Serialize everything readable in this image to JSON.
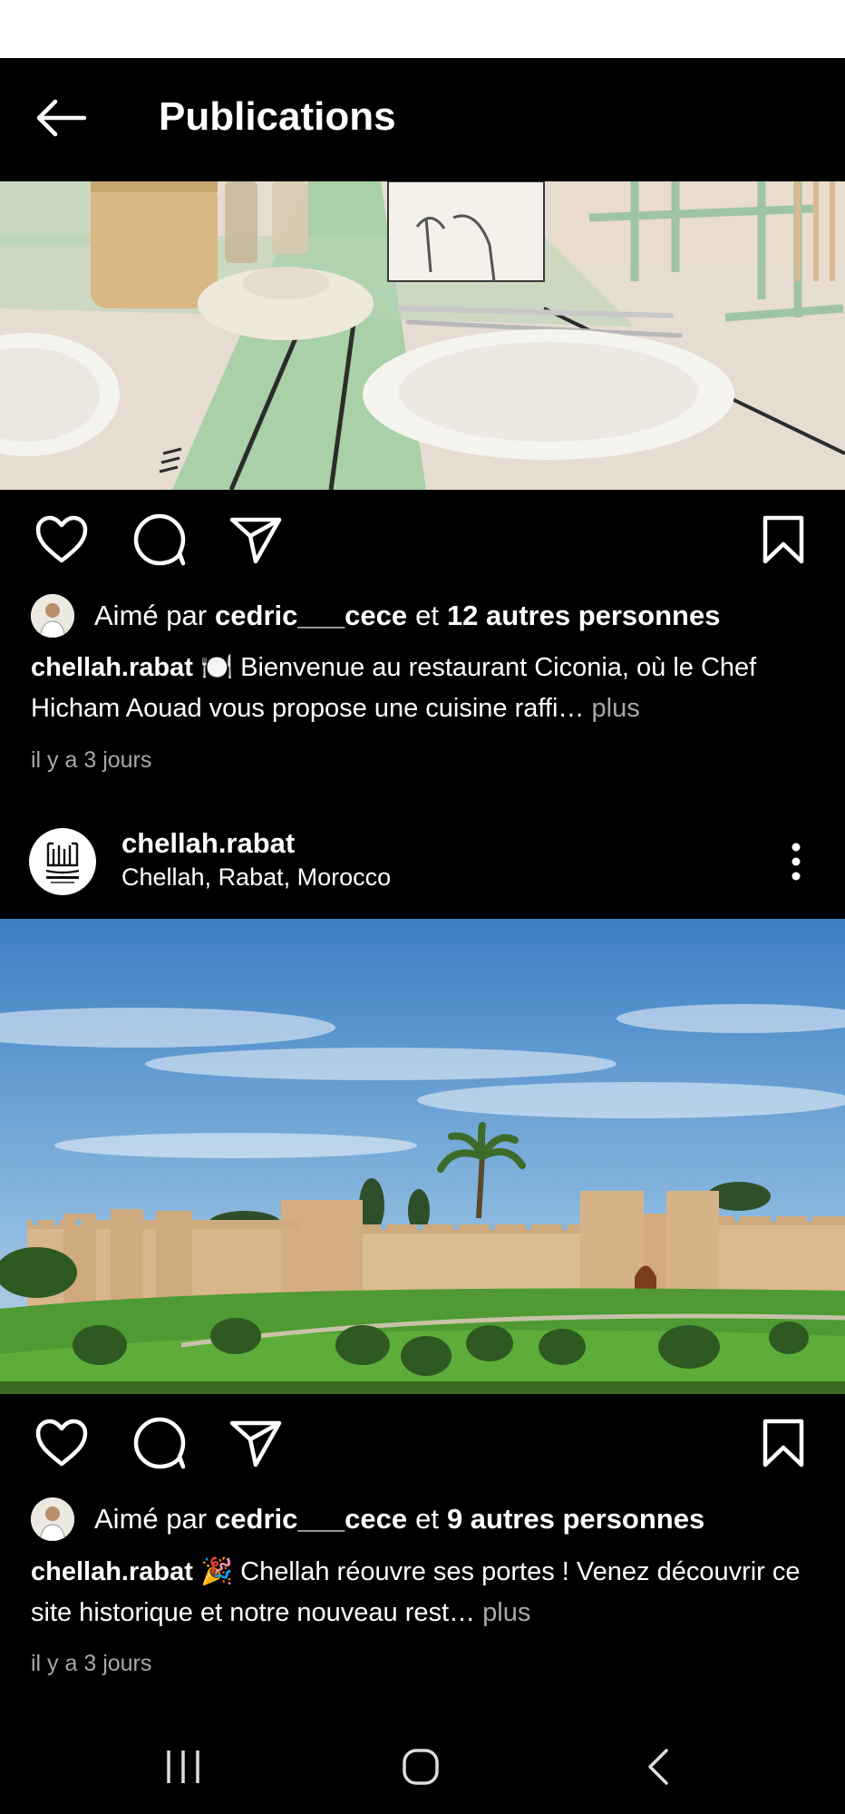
{
  "header": {
    "title": "Publications",
    "back_icon": "arrow-left-icon"
  },
  "posts": [
    {
      "image_alt": "Restaurant table with plates",
      "liked_by": {
        "prefix": "Aimé par",
        "user": "cedric___cece",
        "joiner": "et",
        "others": "12 autres personnes"
      },
      "caption": {
        "user": "chellah.rabat",
        "emoji": "🍽️",
        "text": "Bienvenue au restaurant Ciconia, où le Chef Hicham Aouad vous propose une cuisine raffi…",
        "more": "plus"
      },
      "time": "il y a 3 jours"
    },
    {
      "username": "chellah.rabat",
      "location": "Chellah, Rabat, Morocco",
      "image_alt": "Chellah walls, Rabat",
      "liked_by": {
        "prefix": "Aimé par",
        "user": "cedric___cece",
        "joiner": "et",
        "others": "9 autres personnes"
      },
      "caption": {
        "user": "chellah.rabat",
        "emoji": "🎉",
        "text": "Chellah réouvre ses portes ! Venez découvrir ce site historique et notre nouveau rest…",
        "more": "plus"
      },
      "time": "il y a 3 jours"
    }
  ],
  "icons": [
    "heart-icon",
    "comment-icon",
    "send-icon",
    "bookmark-icon",
    "more-vertical-icon"
  ],
  "navbar": {
    "recents_icon": "recents-icon",
    "home_icon": "home-icon",
    "back_icon": "nav-back-icon"
  },
  "colors": {
    "background": "#000000",
    "text": "#ffffff",
    "muted": "#a8a8a8"
  }
}
